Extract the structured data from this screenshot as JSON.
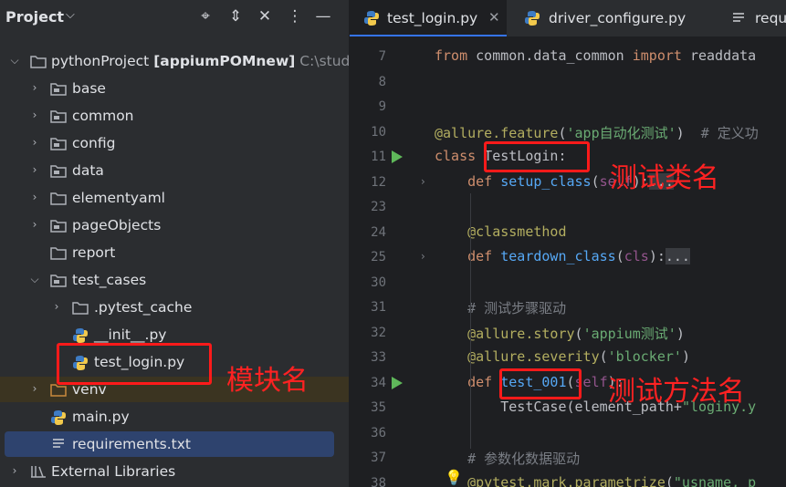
{
  "project_panel": {
    "title": "Project",
    "title_chevron": "⌵",
    "header_icons": [
      "crosshair-icon",
      "expand-collapse-icon",
      "collapse-all-icon",
      "more-options-icon",
      "hide-icon"
    ],
    "root": {
      "name": "pythonProject",
      "module": "[appiumPOMnew]",
      "path": "C:\\stud"
    },
    "folders": [
      "base",
      "common",
      "config",
      "data",
      "elementyaml",
      "pageObjects",
      "report",
      "test_cases"
    ],
    "test_case_children": [
      ".pytest_cache",
      "__init__.py",
      "test_login.py"
    ],
    "venv": "venv",
    "main_file": "main.py",
    "requirements": "requirements.txt",
    "external": "External Libraries"
  },
  "editor": {
    "tabs": [
      {
        "label": "test_login.py",
        "active": true,
        "close": "✕"
      },
      {
        "label": "driver_configure.py",
        "active": false
      },
      {
        "label": "requ",
        "active": false
      }
    ],
    "lines": [
      {
        "n": "7",
        "tokens": [
          [
            "kw",
            "from"
          ],
          [
            "t",
            " common.data_common "
          ],
          [
            "kw",
            "import"
          ],
          [
            "t",
            " readdata"
          ]
        ]
      },
      {
        "n": "8",
        "tokens": []
      },
      {
        "n": "9",
        "tokens": []
      },
      {
        "n": "10",
        "tokens": [
          [
            "deco",
            "@allure.feature"
          ],
          [
            "t",
            "("
          ],
          [
            "str",
            "'app自动化测试'"
          ],
          [
            "t",
            ")  "
          ],
          [
            "cmt",
            "# 定义功"
          ]
        ]
      },
      {
        "n": "11",
        "tokens": [
          [
            "kw",
            "class"
          ],
          [
            "t",
            " TestLogin:"
          ]
        ]
      },
      {
        "n": "12",
        "tokens": [
          [
            "t",
            "    "
          ],
          [
            "kw",
            "def"
          ],
          [
            "t",
            " "
          ],
          [
            "fn",
            "setup_class"
          ],
          [
            "t",
            "("
          ],
          [
            "self",
            "self"
          ],
          [
            "t",
            "):"
          ],
          [
            "fold",
            "..."
          ]
        ]
      },
      {
        "n": "23",
        "tokens": []
      },
      {
        "n": "24",
        "tokens": [
          [
            "t",
            "    "
          ],
          [
            "deco",
            "@classmethod"
          ]
        ]
      },
      {
        "n": "25",
        "tokens": [
          [
            "t",
            "    "
          ],
          [
            "kw",
            "def"
          ],
          [
            "t",
            " "
          ],
          [
            "fn",
            "teardown_class"
          ],
          [
            "t",
            "("
          ],
          [
            "self",
            "cls"
          ],
          [
            "t",
            "):"
          ],
          [
            "fold",
            "..."
          ]
        ]
      },
      {
        "n": "30",
        "tokens": []
      },
      {
        "n": "31",
        "tokens": [
          [
            "t",
            "    "
          ],
          [
            "cmt",
            "# 测试步骤驱动"
          ]
        ]
      },
      {
        "n": "32",
        "tokens": [
          [
            "t",
            "    "
          ],
          [
            "deco",
            "@allure.story"
          ],
          [
            "t",
            "("
          ],
          [
            "str",
            "'appium测试'"
          ],
          [
            "t",
            ")"
          ]
        ]
      },
      {
        "n": "33",
        "tokens": [
          [
            "t",
            "    "
          ],
          [
            "deco",
            "@allure.severity"
          ],
          [
            "t",
            "("
          ],
          [
            "str",
            "'blocker'"
          ],
          [
            "t",
            ")"
          ]
        ]
      },
      {
        "n": "34",
        "tokens": [
          [
            "t",
            "    "
          ],
          [
            "kw",
            "def"
          ],
          [
            "t",
            " "
          ],
          [
            "fn",
            "test_001"
          ],
          [
            "t",
            "("
          ],
          [
            "self",
            "self"
          ],
          [
            "t",
            "):"
          ]
        ]
      },
      {
        "n": "35",
        "tokens": [
          [
            "t",
            "        TestCase(element_path+"
          ],
          [
            "str",
            "\"loginy.y"
          ]
        ]
      },
      {
        "n": "36",
        "tokens": []
      },
      {
        "n": "37",
        "tokens": [
          [
            "t",
            "    "
          ],
          [
            "cmt",
            "# 参数化数据驱动"
          ]
        ]
      },
      {
        "n": "38",
        "tokens": [
          [
            "t",
            "    "
          ],
          [
            "deco",
            "@pytest.mark.parametrize"
          ],
          [
            "t",
            "("
          ],
          [
            "str",
            "\"usname, p"
          ]
        ]
      }
    ]
  },
  "annotations": {
    "class_name": "测试类名",
    "module_name": "模块名",
    "method_name": "测试方法名"
  },
  "colors": {
    "annotation_red": "#ff1a1a",
    "selection": "#2e436e",
    "accent_tab": "#3574f0"
  }
}
